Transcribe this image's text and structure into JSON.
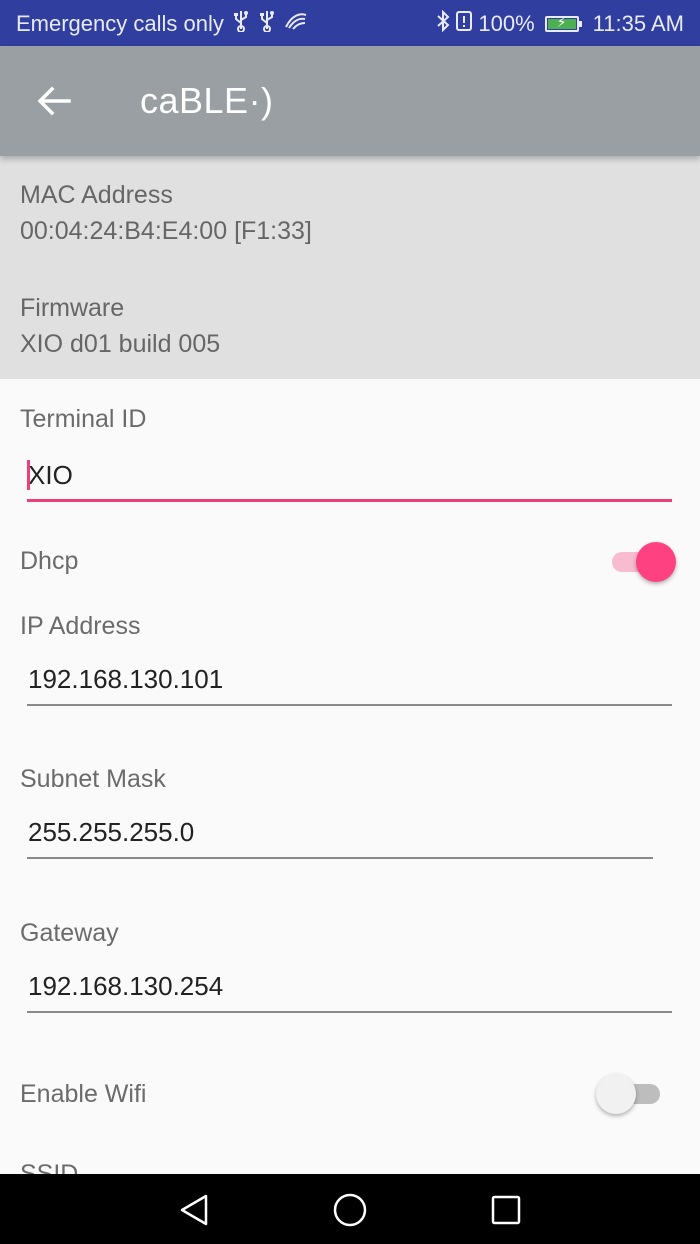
{
  "status_bar": {
    "carrier": "Emergency calls only",
    "battery_percent": "100%",
    "battery_level": 1.0,
    "time": "11:35 AM",
    "left_icons": [
      "usb-icon",
      "usb-icon",
      "swiftkey-icon"
    ],
    "right_icons": [
      "bluetooth-icon",
      "alert-icon",
      "battery-icon"
    ]
  },
  "app_bar": {
    "title": "caBLE·)",
    "back_icon": "arrow-back-icon"
  },
  "info": {
    "mac_label": "MAC Address",
    "mac_value": "00:04:24:B4:E4:00 [F1:33]",
    "firmware_label": "Firmware",
    "firmware_value": "XIO d01 build 005"
  },
  "form": {
    "terminal_id": {
      "label": "Terminal ID",
      "value": "XIO"
    },
    "dhcp": {
      "label": "Dhcp",
      "enabled": true
    },
    "ip_address": {
      "label": "IP Address",
      "value": "192.168.130.101"
    },
    "subnet_mask": {
      "label": "Subnet Mask",
      "value": "255.255.255.0"
    },
    "gateway": {
      "label": "Gateway",
      "value": "192.168.130.254"
    },
    "enable_wifi": {
      "label": "Enable Wifi",
      "enabled": false
    },
    "ssid": {
      "label": "SSID"
    }
  },
  "nav_bar": {
    "icons": [
      "back-triangle-icon",
      "home-circle-icon",
      "recents-square-icon"
    ]
  },
  "colors": {
    "status_bar": "#303f9f",
    "app_bar": "#9a9fa3",
    "accent": "#ff4081",
    "info_bg": "#e0e0e0",
    "battery": "#4caf50"
  }
}
